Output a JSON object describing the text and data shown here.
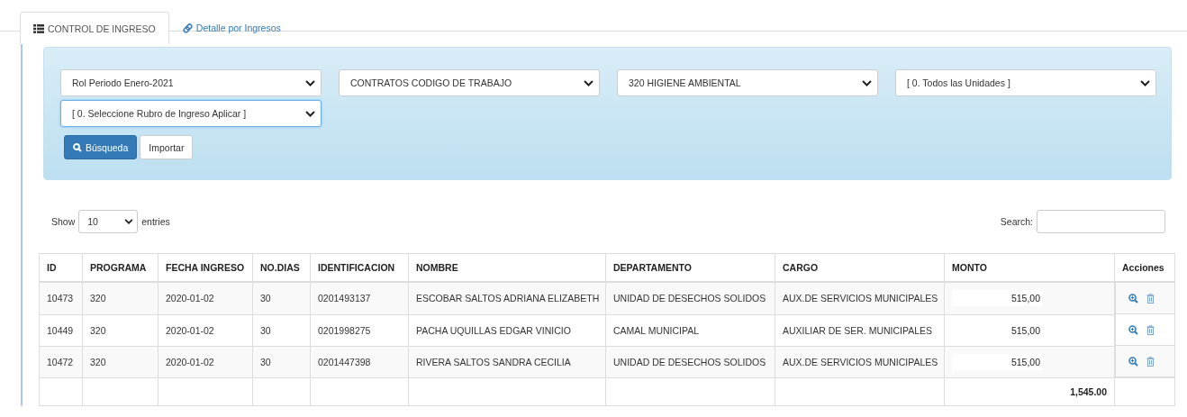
{
  "tabs": [
    {
      "label": "CONTROL DE INGRESO",
      "kind": "list",
      "selected": true
    },
    {
      "label": "Detalle por Ingresos",
      "kind": "link",
      "selected": false
    }
  ],
  "filters": {
    "selects": [
      {
        "value": "Rol Periodo Enero-2021",
        "focused": false
      },
      {
        "value": "CONTRATOS CODIGO DE TRABAJO",
        "focused": false
      },
      {
        "value": "320 HIGIENE AMBIENTAL",
        "focused": false
      },
      {
        "value": "[ 0. Todos las Unidades ]",
        "focused": false
      },
      {
        "value": "[ 0. Seleccione Rubro de Ingreso Aplicar ]",
        "focused": true
      }
    ],
    "buttons": [
      {
        "label": "Búsqueda",
        "kind": "primary"
      },
      {
        "label": "Importar",
        "kind": "default"
      }
    ]
  },
  "length": {
    "before": "Show",
    "value": "10",
    "after": "entries"
  },
  "search": {
    "label": "Search:"
  },
  "table": {
    "columns": [
      "ID",
      "PROGRAMA",
      "FECHA INGRESO",
      "NO.DIAS",
      "IDENTIFICACION",
      "NOMBRE",
      "DEPARTAMENTO",
      "CARGO",
      "MONTO",
      "Acciones"
    ],
    "rows": [
      {
        "cells": [
          "10473",
          "320",
          "2020-01-02",
          "30",
          "0201493137",
          "ESCOBAR SALTOS ADRIANA ELIZABETH",
          "UNIDAD DE DESECHOS SOLIDOS",
          "AUX.DE SERVICIOS MUNICIPALES"
        ],
        "amount": "515,00"
      },
      {
        "cells": [
          "10449",
          "320",
          "2020-01-02",
          "30",
          "0201998275",
          "PACHA UQUILLAS EDGAR VINICIO",
          "CAMAL MUNICIPAL",
          "AUXILIAR DE SER. MUNICIPALES"
        ],
        "amount": "515,00"
      },
      {
        "cells": [
          "10472",
          "320",
          "2020-01-02",
          "30",
          "0201447398",
          "RIVERA SALTOS SANDRA CECILIA",
          "UNIDAD DE DESECHOS SOLIDOS",
          "AUX.DE SERVICIOS MUNICIPALES"
        ],
        "amount": "515,00"
      }
    ],
    "total": "1,545.00"
  }
}
